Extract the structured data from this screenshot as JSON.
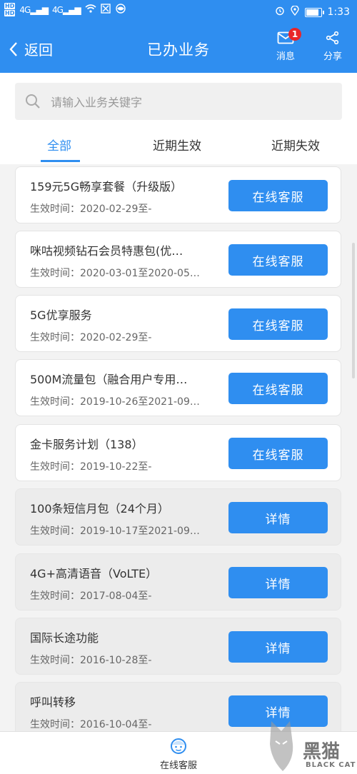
{
  "status_bar": {
    "time": "1:33",
    "network": "4G",
    "battery_level": 0.8
  },
  "header": {
    "back_label": "返回",
    "title": "已办业务",
    "messages_label": "消息",
    "messages_badge": "1",
    "share_label": "分享"
  },
  "search": {
    "placeholder": "请输入业务关键字"
  },
  "tabs": [
    "全部",
    "近期生效",
    "近期失效"
  ],
  "items": [
    {
      "name": "159元5G畅享套餐（升级版）",
      "date": "生效时间：2020-02-29至-",
      "button": "在线客服",
      "active": true
    },
    {
      "name": "咪咕视频钻石会员特惠包(优…",
      "date": "生效时间：2020-03-01至2020-05…",
      "button": "在线客服",
      "active": true
    },
    {
      "name": "5G优享服务",
      "date": "生效时间：2020-02-29至-",
      "button": "在线客服",
      "active": true
    },
    {
      "name": "500M流量包（融合用户专用…",
      "date": "生效时间：2019-10-26至2021-09…",
      "button": "在线客服",
      "active": true
    },
    {
      "name": "金卡服务计划（138）",
      "date": "生效时间：2019-10-22至-",
      "button": "在线客服",
      "active": true
    },
    {
      "name": "100条短信月包（24个月）",
      "date": "生效时间：2019-10-17至2021-09…",
      "button": "详情",
      "active": false
    },
    {
      "name": "4G+高清语音（VoLTE）",
      "date": "生效时间：2017-08-04至-",
      "button": "详情",
      "active": false
    },
    {
      "name": "国际长途功能",
      "date": "生效时间：2016-10-28至-",
      "button": "详情",
      "active": false
    },
    {
      "name": "呼叫转移",
      "date": "生效时间：2016-10-04至-",
      "button": "详情",
      "active": false
    }
  ],
  "bottom_bar": {
    "service_label": "在线客服"
  },
  "watermark": {
    "title": "黑猫",
    "subtitle": "BLACK CAT"
  },
  "colors": {
    "primary": "#2f8ef0",
    "badge": "#e8262a"
  }
}
